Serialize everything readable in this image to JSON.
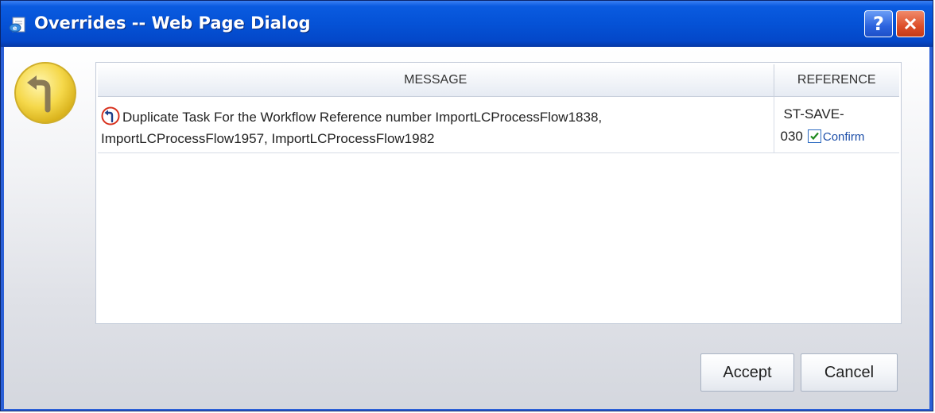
{
  "window": {
    "title": "Overrides -- Web Page Dialog",
    "help_label": "?"
  },
  "table": {
    "columns": [
      "MESSAGE",
      "REFERENCE"
    ],
    "rows": [
      {
        "message": "Duplicate Task For the Workflow Reference number ImportLCProcessFlow1838, ImportLCProcessFlow1957, ImportLCProcessFlow1982",
        "reference_part1": "ST-SAVE-",
        "reference_part2": "030",
        "confirm_label": "Confirm",
        "confirm_checked": true
      }
    ]
  },
  "buttons": {
    "accept": "Accept",
    "cancel": "Cancel"
  },
  "icons": {
    "title": "ie-page-icon",
    "main": "override-arrow-icon",
    "row": "override-arrow-icon"
  },
  "colors": {
    "titlebar": "#0552d6",
    "close_button": "#dd4f2a",
    "icon_yellow": "#f5d84a",
    "icon_red": "#d8321f",
    "link_blue": "#1c4ea8"
  }
}
